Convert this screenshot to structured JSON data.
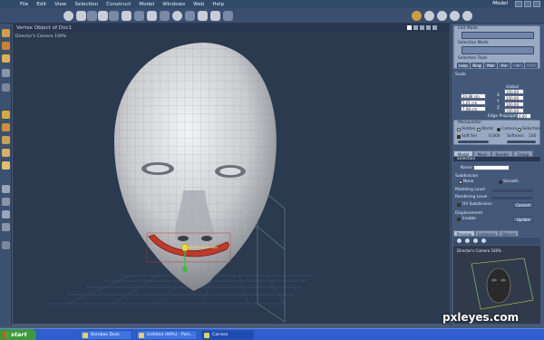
{
  "menu": {
    "items": [
      "File",
      "Edit",
      "View",
      "Selection",
      "Construct",
      "Model",
      "Windows",
      "Web",
      "Help"
    ],
    "mode": "Model"
  },
  "viewport": {
    "title": "Vertex Object of Doc1",
    "camera": "Director's Camera 100%"
  },
  "panel": {
    "edit_mode": "Edit Mode",
    "selection_mode": "Selection Mode",
    "selection_tools": "Selection Tools",
    "tools": [
      "Loop",
      "Ring",
      "Mat",
      "Inv",
      "+",
      "-"
    ],
    "scale": "Scale",
    "global": "Global",
    "fields_left": [
      "20,88 cm",
      "5,01 cm",
      "7,98 cm"
    ],
    "fields_right": [
      "100,00",
      "100,00",
      "100,00"
    ],
    "field_axis": [
      "X",
      "Y",
      "Z"
    ],
    "edge_propagation": "Edge Propagation",
    "edge_propagation_value": "0,00",
    "manipulator": "Manipulator",
    "manip_options": [
      "Hidden",
      "World",
      "Camera",
      "Selection"
    ],
    "soft_sel": "Soft Sel",
    "soft_value": "0,000",
    "softness": "Softness",
    "softness_value": "100",
    "tabs": [
      "Model",
      "Mesh",
      "Render",
      "Group"
    ],
    "selection_header": "Selection",
    "name_label": "Name",
    "subdivision": "Subdivision",
    "sub_options": [
      "None",
      "Smooth"
    ],
    "modeling_level": "Modeling Level",
    "rendering_level": "Rendering Level",
    "uv_subdivision": "UV Subdivision",
    "convert": "Convert",
    "displacement": "Displacement",
    "enable": "Enable",
    "update": "Update",
    "preview_tabs": [
      "Preview",
      "Instances",
      "Objects"
    ],
    "preview_camera": "Director's Camera 100%"
  },
  "taskbar": {
    "start": "start",
    "tasks": [
      "Bamboo Dock",
      "Untitled (90%) - Pain...",
      "Carrara"
    ]
  },
  "watermark": "pxleyes.com",
  "colors": {
    "mouth": "#c0392b",
    "gizmo_green": "#3cbf3c",
    "gizmo_yellow": "#e8d840"
  }
}
